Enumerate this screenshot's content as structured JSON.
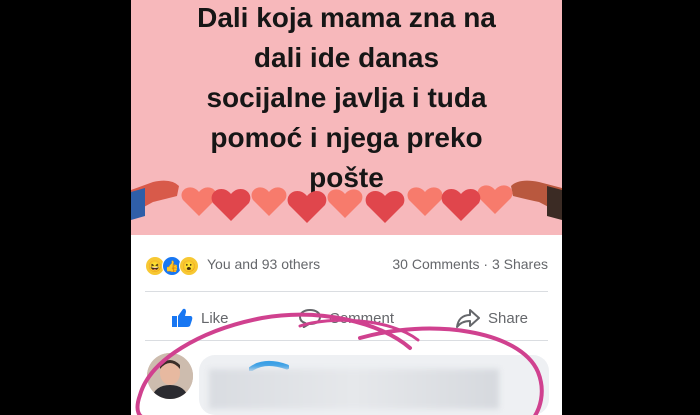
{
  "post": {
    "text_lines": [
      "Dali koja mama zna na",
      "dali ide danas",
      "socijalne javlja i tuda",
      "pomoć i njega preko",
      "pošte"
    ]
  },
  "reactions": {
    "icons": [
      "haha-icon",
      "like-icon",
      "wow-icon"
    ],
    "summary": "You and 93 others",
    "counts": "30 Comments · 3 Shares"
  },
  "actions": {
    "like_label": "Like",
    "comment_label": "Comment",
    "share_label": "Share"
  },
  "colors": {
    "post_background": "#f7b8bb",
    "annotation": "#d0418f",
    "like_blue": "#1877f2",
    "heart_red": "#e0464c",
    "heart_light": "#f77b6c"
  }
}
